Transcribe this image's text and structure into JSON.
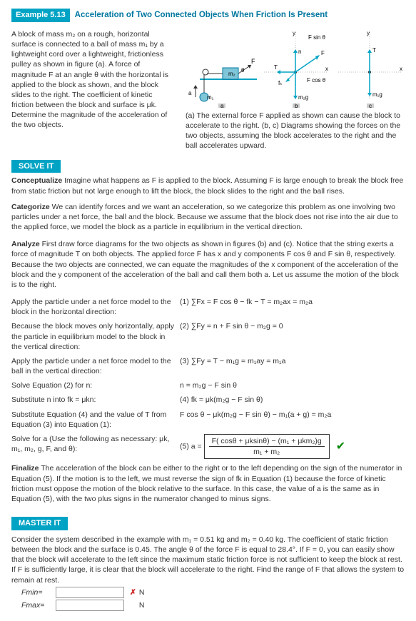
{
  "example": {
    "num": "Example 5.13",
    "title": "Acceleration of Two Connected Objects When Friction Is Present"
  },
  "intro": "A block of mass m₂ on a rough, horizontal surface is connected to a ball of mass m₁ by a lightweight cord over a lightweight, frictionless pulley as shown in figure (a). A force of magnitude F at an angle θ with the horizontal is applied to the block as shown, and the block slides to the right. The coefficient of kinetic friction between the block and surface is μk. Determine the magnitude of the acceleration of the two objects.",
  "fig_caption": "(a) The external force F applied as shown can cause the block to accelerate to the right. (b, c) Diagrams showing the forces on the two objects, assuming the block accelerates to the right and the ball accelerates upward.",
  "solveit": "SOLVE IT",
  "conceptualize": {
    "label": "Conceptualize",
    "text": "Imagine what happens as F is applied to the block. Assuming F is large enough to break the block free from static friction but not large enough to lift the block, the block slides to the right and the ball rises."
  },
  "categorize": {
    "label": "Categorize",
    "text": "We can identify forces and we want an acceleration, so we categorize this problem as one involving two particles under a net force, the ball and the block. Because we assume that the block does not rise into the air due to the applied force, we model the block as a particle in equilibrium in the vertical direction."
  },
  "analyze": {
    "label": "Analyze",
    "text": "First draw force diagrams for the two objects as shown in figures (b) and (c). Notice that the string exerts a force of magnitude T on both objects. The applied force F has x and y components F cos θ and F sin θ, respectively. Because the two objects are connected, we can equate the magnitudes of the x component of the acceleration of the block and the y component of the acceleration of the ball and call them both a. Let us assume the motion of the block is to the right."
  },
  "steps": [
    {
      "text": "Apply the particle under a net force model to the block in the horizontal direction:",
      "eq": "(1)    ∑Fx = F cos θ − fk − T = m₂ax = m₂a"
    },
    {
      "text": "Because the block moves only horizontally, apply the particle in equilibrium model to the block in the vertical direction:",
      "eq": "(2)    ∑Fy = n + F sin θ − m₂g = 0"
    },
    {
      "text": "Apply the particle under a net force model to the ball in the vertical direction:",
      "eq": "(3)    ∑Fy = T − m₁g = m₁ay = m₁a"
    },
    {
      "text": "Solve Equation (2) for n:",
      "eq": "n = m₂g − F sin θ"
    },
    {
      "text": "Substitute n into fk = μkn:",
      "eq": "(4)    fk = μk(m₂g − F sin θ)"
    },
    {
      "text": "Substitute Equation (4) and the value of T from Equation (3) into Equation (1):",
      "eq": "F cos θ − μk(m₂g − F sin θ) − m₁(a + g) = m₂a"
    },
    {
      "text": "Solve for a (Use the following as necessary: μk, m₁, m₂, g, F, and θ):",
      "eq": "(5)    a ="
    }
  ],
  "answer_num": "F( cosθ + μksinθ) − (m₁ + μkm₂)g",
  "answer_den": "m₁ + m₂",
  "finalize": {
    "label": "Finalize",
    "text": "The acceleration of the block can be either to the right or to the left depending on the sign of the numerator in Equation (5). If the motion is to the left, we must reverse the sign of fk in Equation (1) because the force of kinetic friction must oppose the motion of the block relative to the surface. In this case, the value of a is the same as in Equation (5), with the two plus signs in the numerator changed to minus signs."
  },
  "masterit": "MASTER IT",
  "master_text": "Consider the system described in the example with m₁ = 0.51 kg and m₂ = 0.40 kg. The coefficient of static friction between the block and the surface is 0.45. The angle θ of the force F is equal to 28.4°. If F = 0, you can easily show that the block will accelerate to the left since the maximum static friction force is not sufficient to keep the block at rest. If F is sufficiently large, it is clear that the block will accelerate to the right. Find the range of F that allows the system to remain at rest.",
  "inputs": {
    "fmin_label": "Fmin=",
    "fmax_label": "Fmax=",
    "fmin_value": "",
    "fmax_value": "",
    "unit": "N",
    "wrong": "✗"
  },
  "diagram_labels": {
    "a": "a",
    "b": "b",
    "c": "c",
    "m1": "m₁",
    "m2": "m₂",
    "F": "F",
    "Fsin": "F sin θ",
    "Fcos": "F cos θ",
    "T": "T",
    "n": "n",
    "fk": "fₖ",
    "m1g": "m₁g",
    "m2g": "m₂g",
    "theta": "θ",
    "av": "a",
    "xaxis": "x",
    "yaxis": "y"
  }
}
